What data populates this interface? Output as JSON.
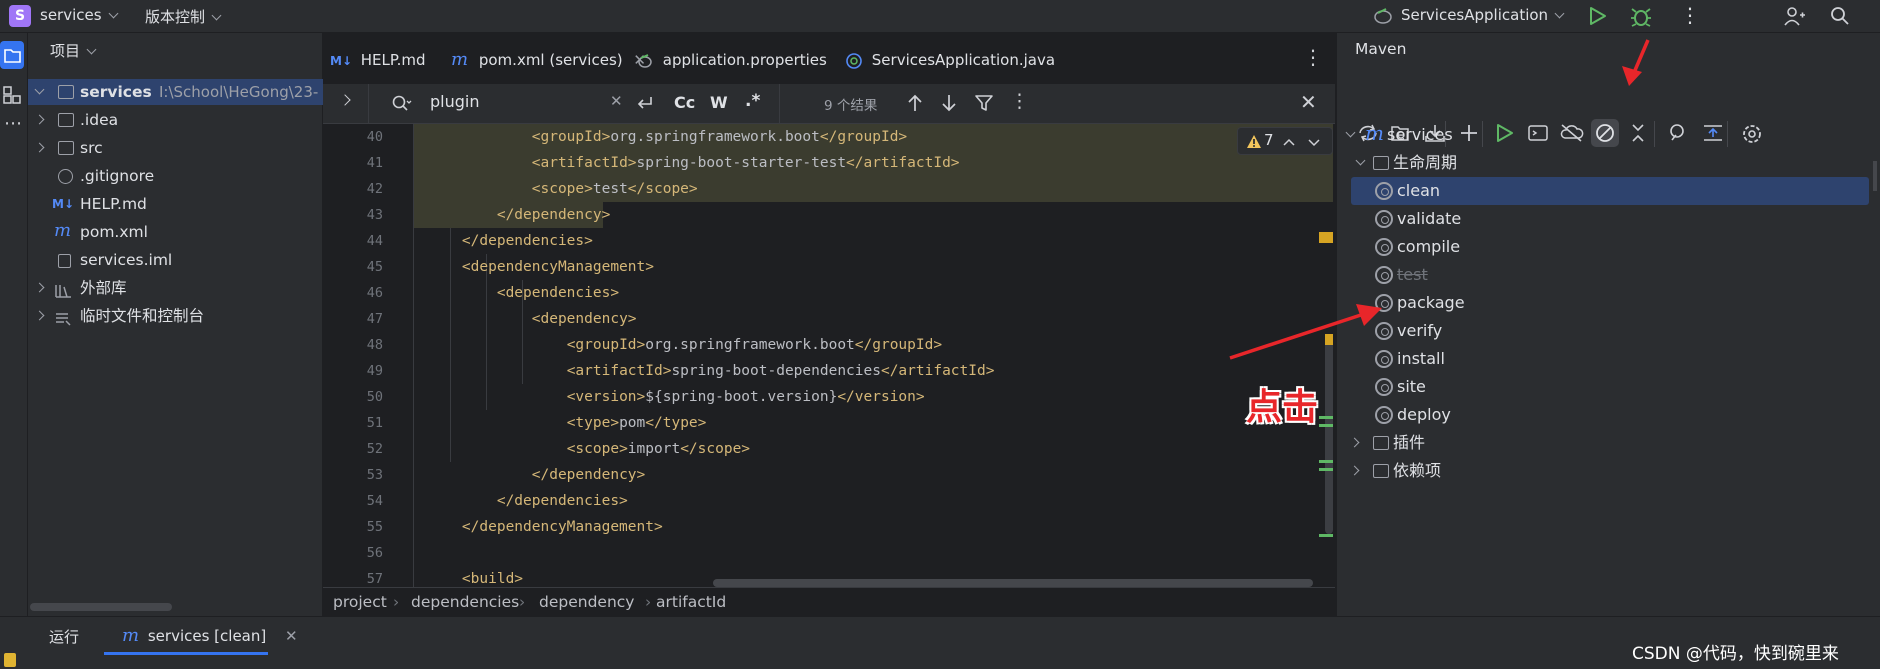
{
  "topbar": {
    "project_badge": "S",
    "project_name": "services",
    "vcs_label": "版本控制",
    "run_config": "ServicesApplication"
  },
  "project_panel": {
    "title": "项目",
    "tree": [
      {
        "label": "services",
        "extra": "I:\\School\\HeGong\\23-"
      },
      {
        "label": ".idea"
      },
      {
        "label": "src"
      },
      {
        "label": ".gitignore"
      },
      {
        "label": "HELP.md"
      },
      {
        "label": "pom.xml"
      },
      {
        "label": "services.iml"
      },
      {
        "label": "外部库"
      },
      {
        "label": "临时文件和控制台"
      }
    ]
  },
  "editor": {
    "tabs": [
      {
        "icon": "M↓",
        "label": "HELP.md"
      },
      {
        "icon": "m",
        "label": "pom.xml (services)"
      },
      {
        "label": "application.properties"
      },
      {
        "label": "ServicesApplication.java"
      }
    ],
    "find": {
      "query": "plugin",
      "case_btn": "Cc",
      "word_btn": "W",
      "regex_btn": ".*",
      "results": "9 个结果"
    },
    "warnings": "7",
    "lines": [
      {
        "n": "40",
        "text": "            <groupId>org.springframework.boot</groupId>"
      },
      {
        "n": "41",
        "text": "            <artifactId>spring-boot-starter-test</artifactId>"
      },
      {
        "n": "42",
        "text": "            <scope>test</scope>"
      },
      {
        "n": "43",
        "text": "        </dependency>"
      },
      {
        "n": "44",
        "text": "    </dependencies>"
      },
      {
        "n": "45",
        "text": "    <dependencyManagement>"
      },
      {
        "n": "46",
        "text": "        <dependencies>"
      },
      {
        "n": "47",
        "text": "            <dependency>"
      },
      {
        "n": "48",
        "text": "                <groupId>org.springframework.boot</groupId>"
      },
      {
        "n": "49",
        "text": "                <artifactId>spring-boot-dependencies</artifactId>"
      },
      {
        "n": "50",
        "text": "                <version>${spring-boot.version}</version>"
      },
      {
        "n": "51",
        "text": "                <type>pom</type>"
      },
      {
        "n": "52",
        "text": "                <scope>import</scope>"
      },
      {
        "n": "53",
        "text": "            </dependency>"
      },
      {
        "n": "54",
        "text": "        </dependencies>"
      },
      {
        "n": "55",
        "text": "    </dependencyManagement>"
      },
      {
        "n": "56",
        "text": ""
      },
      {
        "n": "57",
        "text": "    <build>"
      }
    ],
    "breadcrumb": [
      "project",
      "dependencies",
      "dependency",
      "artifactId"
    ]
  },
  "maven": {
    "title": "Maven",
    "root": "services",
    "lifecycle_label": "生命周期",
    "lifecycle": [
      "clean",
      "validate",
      "compile",
      "test",
      "package",
      "verify",
      "install",
      "site",
      "deploy"
    ],
    "plugins_label": "插件",
    "deps_label": "依赖项",
    "annotation": "点击"
  },
  "bottom": {
    "run_label": "运行",
    "run_tab": "services [clean]",
    "watermark": "CSDN @代码，快到碗里来"
  },
  "colors": {
    "accent": "#3574f0",
    "tag": "#d5b778",
    "annotation_red": "#e8262a"
  }
}
